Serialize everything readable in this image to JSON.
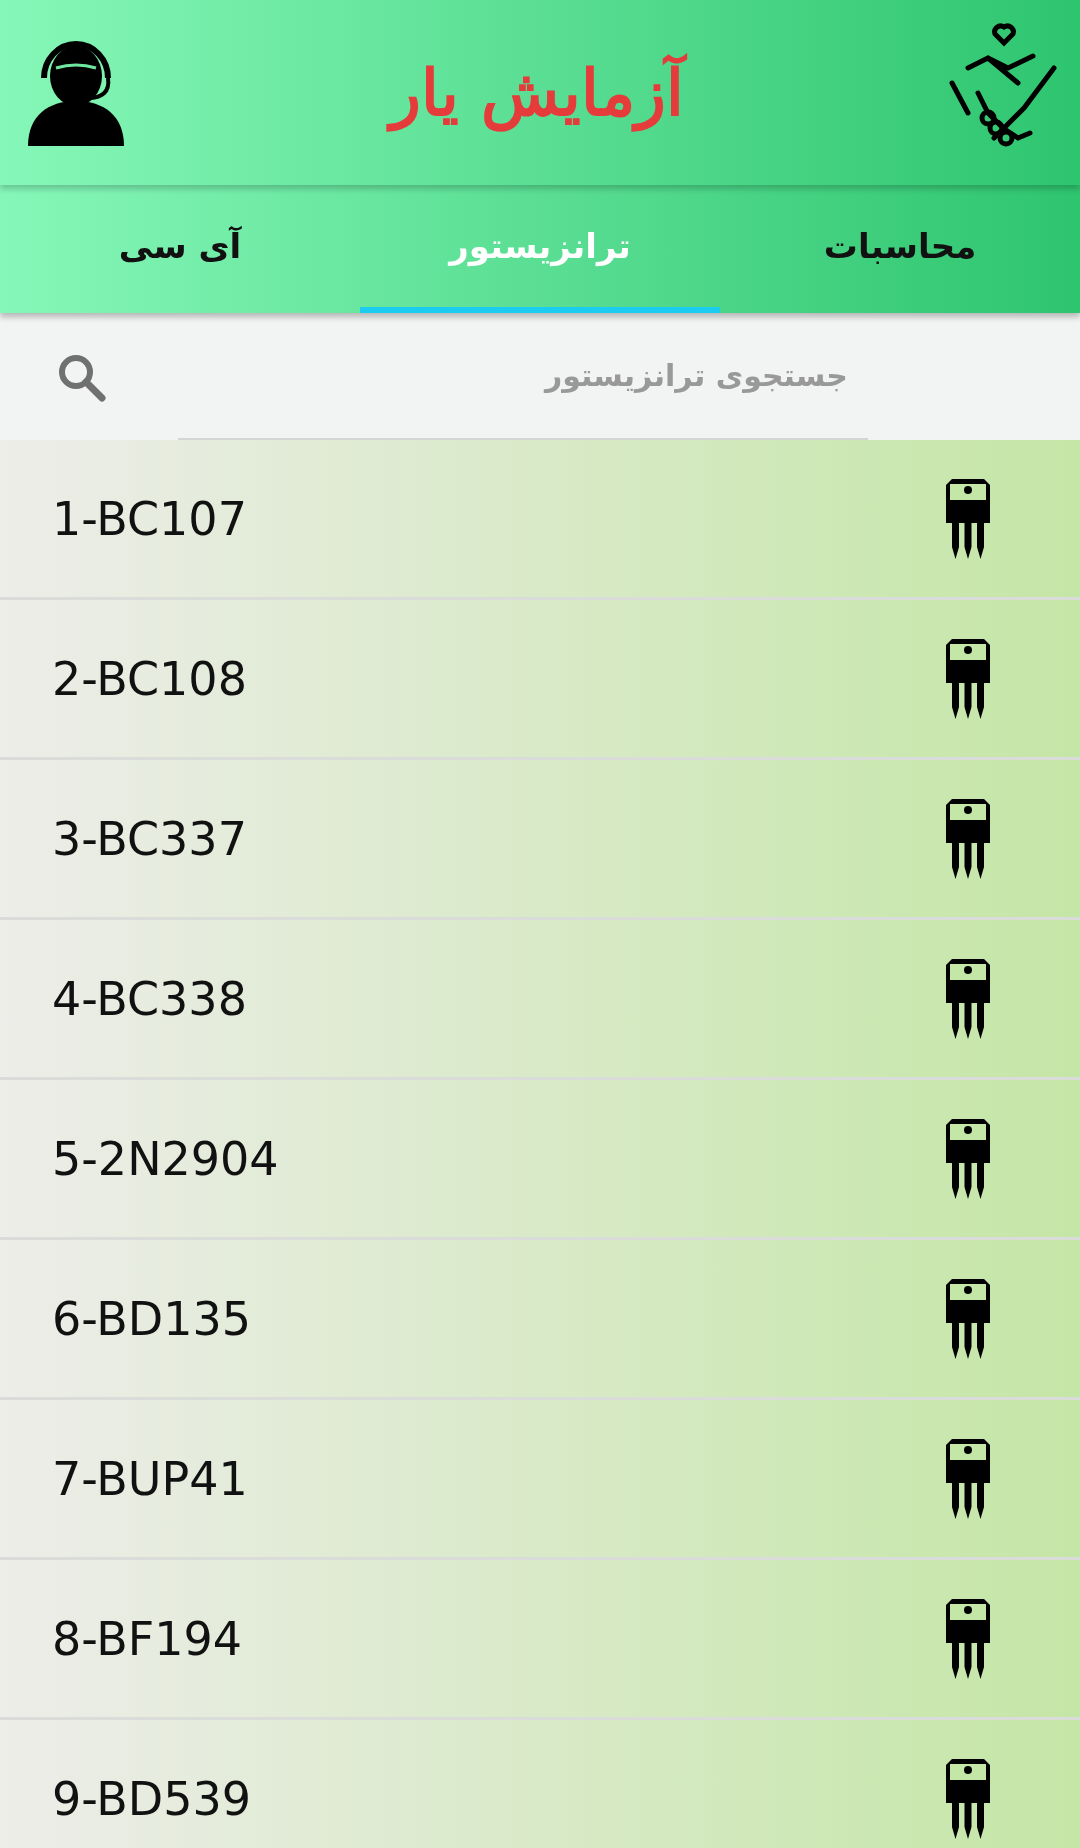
{
  "header": {
    "title": "آزمایش یار"
  },
  "tabs": [
    {
      "label": "محاسبات",
      "selected": false
    },
    {
      "label": "ترانزیستور",
      "selected": true
    },
    {
      "label": "آی سی",
      "selected": false
    }
  ],
  "search": {
    "placeholder": "جستجوی ترانزیستور"
  },
  "items": [
    {
      "label": "1-BC107"
    },
    {
      "label": "2-BC108"
    },
    {
      "label": "3-BC337"
    },
    {
      "label": "4-BC338"
    },
    {
      "label": "5-2N2904"
    },
    {
      "label": "6-BD135"
    },
    {
      "label": "7-BUP41"
    },
    {
      "label": "8-BF194"
    },
    {
      "label": "9-BD539"
    }
  ]
}
